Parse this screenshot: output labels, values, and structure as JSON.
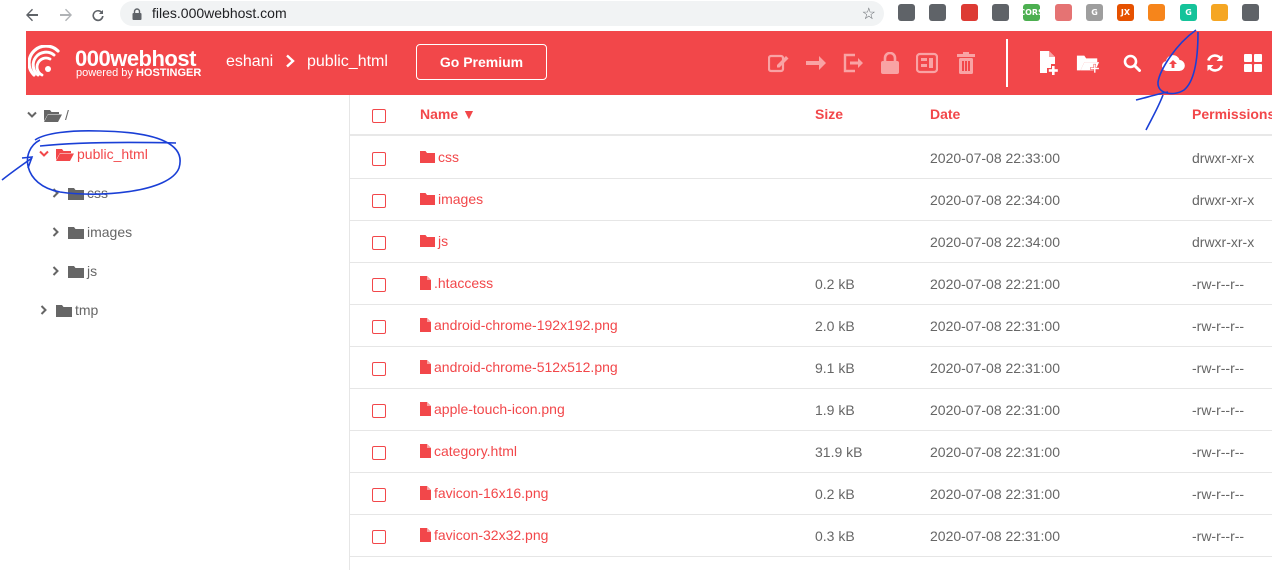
{
  "browser": {
    "url": "files.000webhost.com",
    "icons": [
      "back-icon",
      "forward-icon",
      "reload-icon",
      "lock-icon",
      "star-icon"
    ],
    "extensions": [
      {
        "name": "extension-1-icon",
        "label": "",
        "color": "#5f6368"
      },
      {
        "name": "extension-gear-icon",
        "label": "",
        "color": "#5f6368"
      },
      {
        "name": "angular-extension-icon",
        "label": "",
        "color": "#dd3b34"
      },
      {
        "name": "extension-circle-icon",
        "label": "",
        "color": "#5f6368"
      },
      {
        "name": "cors-extension-icon",
        "label": "CORS",
        "color": "#4caf50"
      },
      {
        "name": "extension-block-icon",
        "label": "",
        "color": "#e57373"
      },
      {
        "name": "grammar-extension-icon",
        "label": "G",
        "color": "#9e9e9e"
      },
      {
        "name": "jx-extension-icon",
        "label": "JX",
        "color": "#e65100"
      },
      {
        "name": "metamask-extension-icon",
        "label": "",
        "color": "#f6851b"
      },
      {
        "name": "grammarly-extension-icon",
        "label": "G",
        "color": "#15c39a"
      },
      {
        "name": "extension-orange-icon",
        "label": "",
        "color": "#f5a623"
      },
      {
        "name": "extensions-puzzle-icon",
        "label": "",
        "color": "#5f6368"
      }
    ]
  },
  "header": {
    "brand_title": "000webhost",
    "brand_sub_prefix": "powered by",
    "brand_sub_name": "HOSTINGER",
    "breadcrumb": [
      "eshani",
      "public_html"
    ],
    "premium_label": "Go Premium",
    "disabled_actions": [
      "edit-icon",
      "move-icon",
      "rename-icon",
      "permissions-icon",
      "archive-icon",
      "delete-icon"
    ],
    "actions": [
      "new-file-icon",
      "new-folder-icon",
      "search-icon",
      "upload-icon",
      "refresh-icon",
      "grid-view-icon"
    ],
    "accent": "#f2474a"
  },
  "tree": [
    {
      "label": "/",
      "level": 0,
      "expanded": true,
      "active": false
    },
    {
      "label": "public_html",
      "level": 1,
      "expanded": true,
      "active": true
    },
    {
      "label": "css",
      "level": 2,
      "expanded": false,
      "active": false
    },
    {
      "label": "images",
      "level": 2,
      "expanded": false,
      "active": false
    },
    {
      "label": "js",
      "level": 2,
      "expanded": false,
      "active": false
    },
    {
      "label": "tmp",
      "level": 1,
      "expanded": false,
      "active": false
    }
  ],
  "table": {
    "columns": {
      "name": "Name ▼",
      "size": "Size",
      "date": "Date",
      "permissions": "Permissions"
    },
    "rows": [
      {
        "type": "folder",
        "name": "css",
        "size": "",
        "date": "2020-07-08 22:33:00",
        "perm": "drwxr-xr-x"
      },
      {
        "type": "folder",
        "name": "images",
        "size": "",
        "date": "2020-07-08 22:34:00",
        "perm": "drwxr-xr-x"
      },
      {
        "type": "folder",
        "name": "js",
        "size": "",
        "date": "2020-07-08 22:34:00",
        "perm": "drwxr-xr-x"
      },
      {
        "type": "file",
        "name": ".htaccess",
        "size": "0.2 kB",
        "date": "2020-07-08 22:21:00",
        "perm": "-rw-r--r--"
      },
      {
        "type": "file",
        "name": "android-chrome-192x192.png",
        "size": "2.0 kB",
        "date": "2020-07-08 22:31:00",
        "perm": "-rw-r--r--"
      },
      {
        "type": "file",
        "name": "android-chrome-512x512.png",
        "size": "9.1 kB",
        "date": "2020-07-08 22:31:00",
        "perm": "-rw-r--r--"
      },
      {
        "type": "file",
        "name": "apple-touch-icon.png",
        "size": "1.9 kB",
        "date": "2020-07-08 22:31:00",
        "perm": "-rw-r--r--"
      },
      {
        "type": "file",
        "name": "category.html",
        "size": "31.9 kB",
        "date": "2020-07-08 22:31:00",
        "perm": "-rw-r--r--"
      },
      {
        "type": "file",
        "name": "favicon-16x16.png",
        "size": "0.2 kB",
        "date": "2020-07-08 22:31:00",
        "perm": "-rw-r--r--"
      },
      {
        "type": "file",
        "name": "favicon-32x32.png",
        "size": "0.3 kB",
        "date": "2020-07-08 22:31:00",
        "perm": "-rw-r--r--"
      }
    ]
  }
}
